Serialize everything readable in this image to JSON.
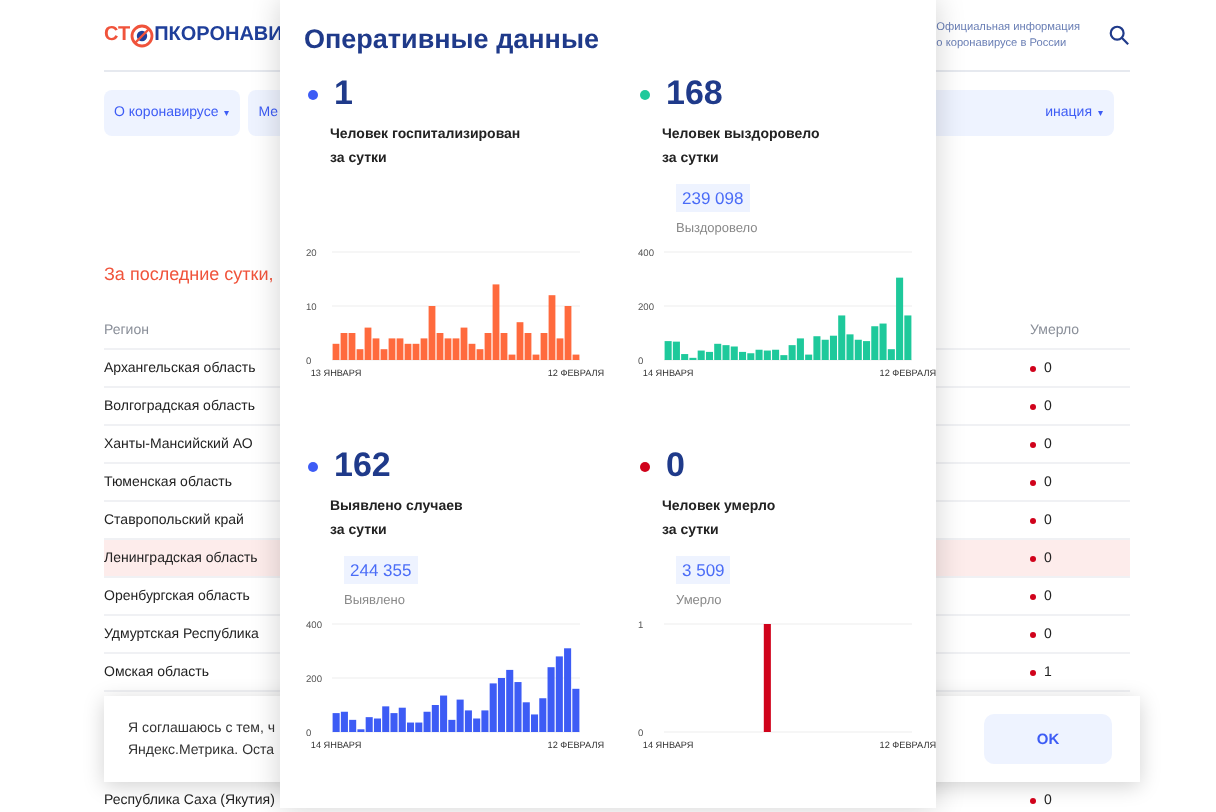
{
  "header": {
    "logo_parts": [
      "СТ",
      "ПКОРОНАВИ"
    ],
    "info_lines": [
      "Официальная информация",
      "о коронавирусе в России"
    ]
  },
  "nav": [
    {
      "label": "О коронавирусе",
      "caret": "▾"
    },
    {
      "label": "Ме"
    },
    {
      "label": "инация",
      "caret": "▾"
    }
  ],
  "section_title": "За последние сутки,",
  "table": {
    "columns": [
      "Регион",
      "Умерло"
    ],
    "rows": [
      {
        "region": "Архангельская область",
        "died": "0",
        "selected": false
      },
      {
        "region": "Волгоградская область",
        "died": "0",
        "selected": false
      },
      {
        "region": "Ханты-Мансийский АО",
        "died": "0",
        "selected": false
      },
      {
        "region": "Тюменская область",
        "died": "0",
        "selected": false
      },
      {
        "region": "Ставропольский край",
        "died": "0",
        "selected": false
      },
      {
        "region": "Ленинградская область",
        "died": "0",
        "selected": true
      },
      {
        "region": "Оренбургская область",
        "died": "0",
        "selected": false
      },
      {
        "region": "Удмуртская Республика",
        "died": "0",
        "selected": false
      },
      {
        "region": "Омская область",
        "died": "1",
        "selected": false
      },
      {
        "region": "Республика Саха (Якутия)",
        "died": "0",
        "selected": false
      }
    ]
  },
  "cookie_banner": {
    "lines": [
      "Я соглашаюсь с тем, ч",
      "Яндекс.Метрика. Оста"
    ],
    "button": "OK"
  },
  "modal": {
    "title": "Оперативные данные",
    "cards": [
      {
        "value": "1",
        "color": "#3d5cf5",
        "label_lines": [
          "Человек госпитализирован",
          "за сутки"
        ],
        "chart_data": {
          "type": "bar",
          "yticks": [
            0,
            10,
            20
          ],
          "ylim": [
            0,
            20
          ],
          "categories": [
            "13 ЯНВАРЯ",
            null,
            null,
            null,
            null,
            null,
            null,
            null,
            null,
            null,
            null,
            null,
            null,
            null,
            null,
            null,
            null,
            null,
            null,
            null,
            null,
            null,
            null,
            null,
            null,
            null,
            null,
            null,
            null,
            null,
            "12 ФЕВРАЛЯ"
          ],
          "series": [
            {
              "color": "#ff6a3d",
              "values": [
                3,
                5,
                5,
                2,
                6,
                4,
                2,
                4,
                4,
                3,
                3,
                4,
                10,
                5,
                4,
                4,
                6,
                3,
                2,
                5,
                14,
                5,
                1,
                7,
                5,
                1,
                5,
                12,
                4,
                10,
                1
              ]
            }
          ]
        }
      },
      {
        "value": "168",
        "color": "#1ec99b",
        "label_lines": [
          "Человек выздоровело",
          "за сутки"
        ],
        "total": "239 098",
        "total_label": "Выздоровело",
        "chart_data": {
          "type": "bar",
          "yticks": [
            0,
            200,
            400
          ],
          "ylim": [
            0,
            400
          ],
          "categories": [
            "14 ЯНВАРЯ",
            null,
            null,
            null,
            null,
            null,
            null,
            null,
            null,
            null,
            null,
            null,
            null,
            null,
            null,
            null,
            null,
            null,
            null,
            null,
            null,
            null,
            null,
            null,
            null,
            null,
            null,
            null,
            null,
            "12 ФЕВРАЛЯ"
          ],
          "series": [
            {
              "color": "#1ec99b",
              "values": [
                70,
                68,
                22,
                8,
                35,
                30,
                60,
                55,
                50,
                30,
                25,
                38,
                35,
                38,
                18,
                55,
                80,
                20,
                88,
                75,
                90,
                165,
                95,
                75,
                70,
                125,
                135,
                40,
                305,
                165
              ]
            }
          ]
        }
      },
      {
        "value": "162",
        "color": "#3d5cf5",
        "label_lines": [
          "Выявлено случаев",
          "за сутки"
        ],
        "total": "244 355",
        "total_label": "Выявлено",
        "chart_data": {
          "type": "bar",
          "yticks": [
            0,
            200,
            400
          ],
          "ylim": [
            0,
            400
          ],
          "categories": [
            "14 ЯНВАРЯ",
            null,
            null,
            null,
            null,
            null,
            null,
            null,
            null,
            null,
            null,
            null,
            null,
            null,
            null,
            null,
            null,
            null,
            null,
            null,
            null,
            null,
            null,
            null,
            null,
            null,
            null,
            null,
            null,
            "12 ФЕВРАЛЯ"
          ],
          "series": [
            {
              "color": "#3d5cf5",
              "values": [
                70,
                75,
                45,
                10,
                55,
                50,
                95,
                70,
                90,
                35,
                35,
                75,
                100,
                135,
                45,
                120,
                80,
                50,
                80,
                180,
                200,
                230,
                185,
                110,
                65,
                125,
                240,
                280,
                310,
                160
              ]
            }
          ]
        }
      },
      {
        "value": "0",
        "color": "#d0021b",
        "label_lines": [
          "Человек умерло",
          "за сутки"
        ],
        "total": "3 509",
        "total_label": "Умерло",
        "chart_data": {
          "type": "bar",
          "yticks": [
            0,
            1
          ],
          "ylim": [
            0,
            1
          ],
          "categories": [
            "14 ЯНВАРЯ",
            null,
            null,
            null,
            null,
            null,
            null,
            null,
            null,
            null,
            null,
            null,
            null,
            null,
            null,
            null,
            null,
            null,
            null,
            null,
            null,
            null,
            null,
            null,
            null,
            null,
            null,
            null,
            null,
            "12 ФЕВРАЛЯ"
          ],
          "series": [
            {
              "color": "#d0021b",
              "values": [
                0,
                0,
                0,
                0,
                0,
                0,
                0,
                0,
                0,
                0,
                0,
                0,
                1,
                0,
                0,
                0,
                0,
                0,
                0,
                0,
                0,
                0,
                0,
                0,
                0,
                0,
                0,
                0,
                0,
                0
              ]
            }
          ]
        }
      }
    ]
  }
}
